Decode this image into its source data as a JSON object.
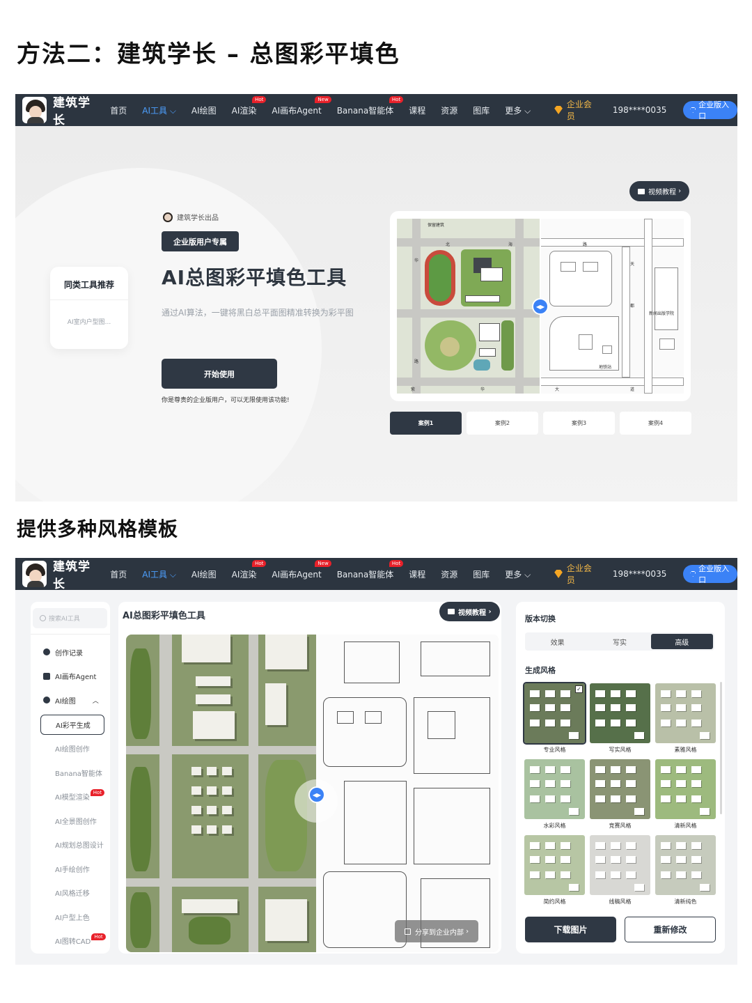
{
  "headings": {
    "method": "方法二：建筑学长 – 总图彩平填色",
    "styles": "提供多种风格模板"
  },
  "nav": {
    "brand": "建筑学长",
    "items": [
      {
        "label": "首页",
        "badge": "",
        "active": false
      },
      {
        "label": "AI工具",
        "badge": "",
        "active": true,
        "dropdown": true
      },
      {
        "label": "AI绘图",
        "badge": ""
      },
      {
        "label": "AI渲染",
        "badge": "Hot"
      },
      {
        "label": "AI画布Agent",
        "badge": "New"
      },
      {
        "label": "Banana智能体",
        "badge": "Hot"
      },
      {
        "label": "课程",
        "badge": ""
      },
      {
        "label": "资源",
        "badge": ""
      },
      {
        "label": "图库",
        "badge": ""
      },
      {
        "label": "更多",
        "badge": "",
        "dropdown": true
      }
    ],
    "vip": "企业会员",
    "phone": "198****0035",
    "enterprise_entry": "企业版入口"
  },
  "hero": {
    "recommend_title": "同类工具推荐",
    "recommend_item": "AI室内户型图...",
    "by_line": "建筑学长出品",
    "tag": "企业版用户专属",
    "title": "AI总图彩平填色工具",
    "desc": "通过AI算法，一键将黑白总平面图精准转换为彩平图",
    "start": "开始使用",
    "hint": "你是尊贵的企业版用户，可以无限使用该功能!",
    "video": "视频教程",
    "plan_labels": {
      "top_left": "保留建筑",
      "north1": "北",
      "north2": "海",
      "north3": "路",
      "west1": "华",
      "west2": "路",
      "east1": "天",
      "east2": "都",
      "south1": "紫",
      "south2": "华",
      "south3": "大",
      "south4": "道",
      "school": "新闻出版学院",
      "metro": "地铁站"
    },
    "cases": [
      {
        "label": "案例1",
        "active": true
      },
      {
        "label": "案例2",
        "active": false
      },
      {
        "label": "案例3",
        "active": false
      },
      {
        "label": "案例4",
        "active": false
      }
    ]
  },
  "app": {
    "search_placeholder": "搜索AI工具",
    "sidebar": {
      "history": "创作记录",
      "agent": "AI画布Agent",
      "drawing": "AI绘图",
      "subitems": [
        {
          "label": "AI彩平生成",
          "selected": true,
          "badge": ""
        },
        {
          "label": "AI绘图创作",
          "badge": ""
        },
        {
          "label": "Banana智能体",
          "badge": ""
        },
        {
          "label": "AI模型渲染",
          "badge": "Hot"
        },
        {
          "label": "AI全景图创作",
          "badge": ""
        },
        {
          "label": "AI规划总图设计",
          "badge": ""
        },
        {
          "label": "AI手绘创作",
          "badge": ""
        },
        {
          "label": "AI风格迁移",
          "badge": ""
        },
        {
          "label": "AI户型上色",
          "badge": ""
        },
        {
          "label": "AI图转CAD",
          "badge": "Hot"
        }
      ]
    },
    "main_title": "AI总图彩平填色工具",
    "video": "视频教程",
    "share": "分享到企业内部",
    "panel": {
      "version_title": "版本切换",
      "versions": [
        {
          "label": "效果",
          "active": false
        },
        {
          "label": "写实",
          "active": false
        },
        {
          "label": "高级",
          "active": true
        }
      ],
      "style_title": "生成风格",
      "styles": [
        {
          "label": "专业风格",
          "selected": true,
          "bg": "#6b7b5a"
        },
        {
          "label": "写实风格",
          "selected": false,
          "bg": "#56704a"
        },
        {
          "label": "素雅风格",
          "selected": false,
          "bg": "#b9c0a8"
        },
        {
          "label": "水彩风格",
          "selected": false,
          "bg": "#a9c2a0"
        },
        {
          "label": "竞赛风格",
          "selected": false,
          "bg": "#8a9474"
        },
        {
          "label": "清新风格",
          "selected": false,
          "bg": "#9dba7e"
        },
        {
          "label": "简约风格",
          "selected": false,
          "bg": "#b7c6a4"
        },
        {
          "label": "线稿风格",
          "selected": false,
          "bg": "#d8d8d4"
        },
        {
          "label": "清新纯色",
          "selected": false,
          "bg": "#c6cbbd"
        }
      ],
      "download": "下载图片",
      "regenerate": "重新修改"
    }
  }
}
